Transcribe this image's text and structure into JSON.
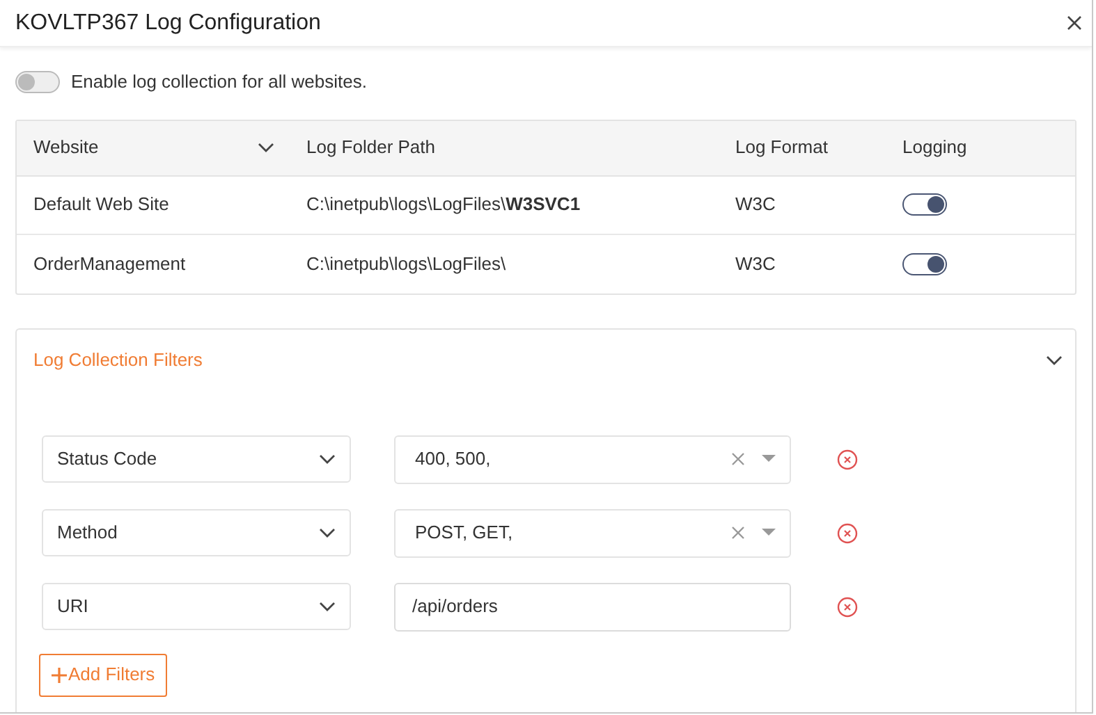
{
  "window": {
    "title": "KOVLTP367 Log Configuration"
  },
  "enable_all": {
    "label": "Enable log collection for all websites.",
    "on": false
  },
  "table": {
    "columns": [
      "Website",
      "Log Folder Path",
      "Log Format",
      "Logging"
    ],
    "rows": [
      {
        "website": "Default Web Site",
        "path": "C:\\inetpub\\logs\\LogFiles\\**W3SVC1**",
        "format": "W3C",
        "logging": true
      },
      {
        "website": "OrderManagement",
        "path": "C:\\inetpub\\logs\\LogFiles\\",
        "format": "W3C",
        "logging": true
      }
    ]
  },
  "filters": {
    "title": "Log Collection Filters",
    "expanded": true,
    "items": [
      {
        "field": "Status Code",
        "kind": "multiselect",
        "value": "400, 500,"
      },
      {
        "field": "Method",
        "kind": "multiselect",
        "value": "POST, GET,"
      },
      {
        "field": "URI",
        "kind": "text",
        "value": "/api/orders"
      }
    ],
    "add_button": "Add Filters"
  }
}
